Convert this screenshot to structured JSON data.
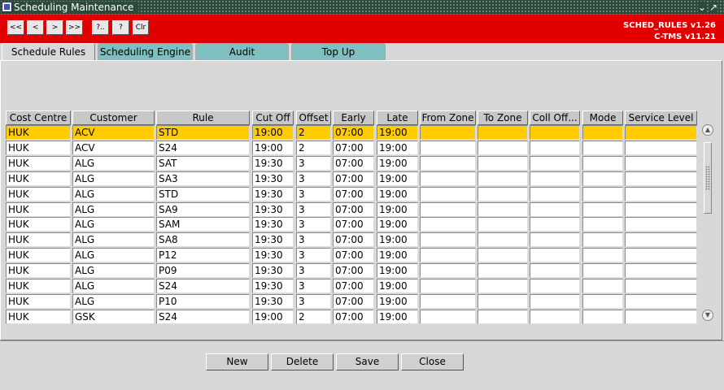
{
  "window": {
    "title": "Scheduling Maintenance",
    "minimize_glyph": "⌄",
    "maximize_glyph": "↗"
  },
  "toolbar": {
    "first_label": "<<",
    "prev_label": "<",
    "next_label": ">",
    "last_label": ">>",
    "query_label": "?..",
    "help_label": "?",
    "clear_label": "Clr"
  },
  "version": {
    "module": "SCHED_RULES v1.26",
    "system": "C-TMS v11.21"
  },
  "tabs": [
    {
      "label": "Schedule Rules",
      "active": true
    },
    {
      "label": "Scheduling Engine",
      "active": false
    },
    {
      "label": "Audit",
      "active": false
    },
    {
      "label": "Top Up",
      "active": false
    }
  ],
  "table": {
    "headers": [
      "Cost Centre",
      "Customer",
      "Rule",
      "Cut Off",
      "Offset",
      "Early",
      "Late",
      "From Zone",
      "To Zone",
      "Coll Off...",
      "Mode",
      "Service Level"
    ],
    "rows": [
      [
        "HUK",
        "ACV",
        "STD",
        "19:00",
        "2",
        "07:00",
        "19:00",
        "",
        "",
        "",
        "",
        ""
      ],
      [
        "HUK",
        "ACV",
        "S24",
        "19:00",
        "2",
        "07:00",
        "19:00",
        "",
        "",
        "",
        "",
        ""
      ],
      [
        "HUK",
        "ALG",
        "SAT",
        "19:30",
        "3",
        "07:00",
        "19:00",
        "",
        "",
        "",
        "",
        ""
      ],
      [
        "HUK",
        "ALG",
        "SA3",
        "19:30",
        "3",
        "07:00",
        "19:00",
        "",
        "",
        "",
        "",
        ""
      ],
      [
        "HUK",
        "ALG",
        "STD",
        "19:30",
        "3",
        "07:00",
        "19:00",
        "",
        "",
        "",
        "",
        ""
      ],
      [
        "HUK",
        "ALG",
        "SA9",
        "19:30",
        "3",
        "07:00",
        "19:00",
        "",
        "",
        "",
        "",
        ""
      ],
      [
        "HUK",
        "ALG",
        "SAM",
        "19:30",
        "3",
        "07:00",
        "19:00",
        "",
        "",
        "",
        "",
        ""
      ],
      [
        "HUK",
        "ALG",
        "SA8",
        "19:30",
        "3",
        "07:00",
        "19:00",
        "",
        "",
        "",
        "",
        ""
      ],
      [
        "HUK",
        "ALG",
        "P12",
        "19:30",
        "3",
        "07:00",
        "19:00",
        "",
        "",
        "",
        "",
        ""
      ],
      [
        "HUK",
        "ALG",
        "P09",
        "19:30",
        "3",
        "07:00",
        "19:00",
        "",
        "",
        "",
        "",
        ""
      ],
      [
        "HUK",
        "ALG",
        "S24",
        "19:30",
        "3",
        "07:00",
        "19:00",
        "",
        "",
        "",
        "",
        ""
      ],
      [
        "HUK",
        "ALG",
        "P10",
        "19:30",
        "3",
        "07:00",
        "19:00",
        "",
        "",
        "",
        "",
        ""
      ],
      [
        "HUK",
        "GSK",
        "S24",
        "19:00",
        "2",
        "07:00",
        "19:00",
        "",
        "",
        "",
        "",
        ""
      ]
    ],
    "selected_row": 0
  },
  "actions": {
    "new_label": "New",
    "delete_label": "Delete",
    "save_label": "Save",
    "close_label": "Close"
  },
  "colors": {
    "toolbar": "#e00000",
    "selected_row": "#ffcc00",
    "inactive_tab": "#7fbfbf"
  }
}
